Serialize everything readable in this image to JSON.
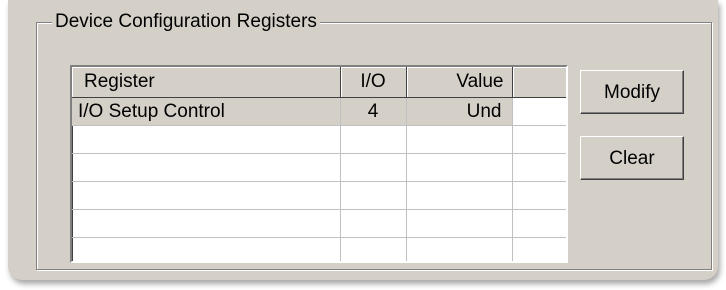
{
  "group": {
    "title": "Device Configuration Registers"
  },
  "table": {
    "columns": [
      "Register",
      "I/O",
      "Value",
      ""
    ],
    "rows": [
      {
        "register": "I/O Setup Control",
        "io": "4",
        "value": "Und",
        "extra": ""
      },
      {
        "register": "",
        "io": "",
        "value": "",
        "extra": ""
      },
      {
        "register": "",
        "io": "",
        "value": "",
        "extra": ""
      },
      {
        "register": "",
        "io": "",
        "value": "",
        "extra": ""
      },
      {
        "register": "",
        "io": "",
        "value": "",
        "extra": ""
      },
      {
        "register": "",
        "io": "",
        "value": "",
        "extra": ""
      }
    ]
  },
  "buttons": {
    "modify": "Modify",
    "clear": "Clear"
  }
}
